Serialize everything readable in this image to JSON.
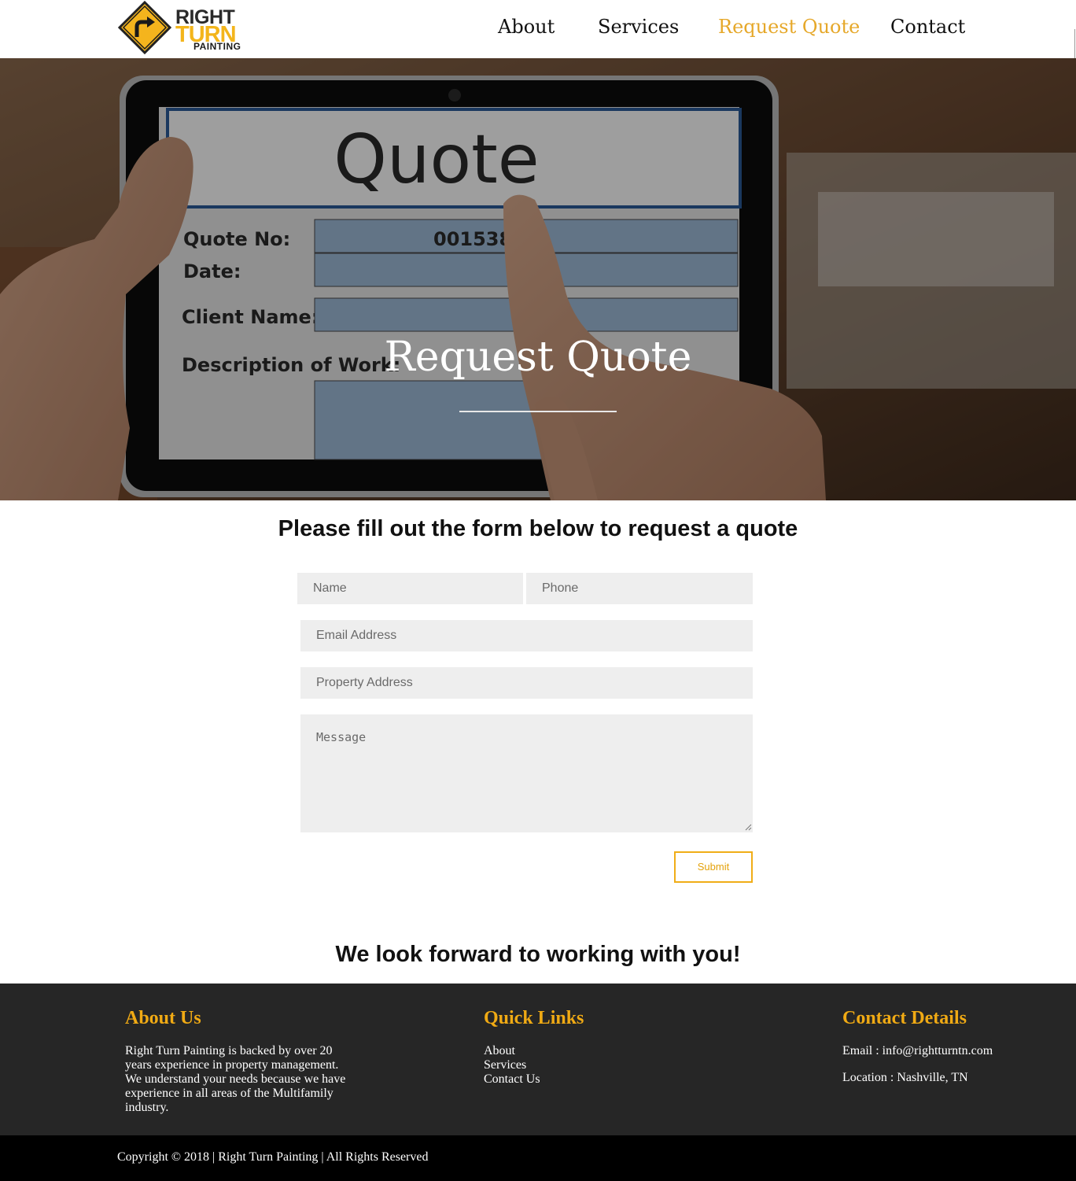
{
  "brand": {
    "logo_line1": "RIGHT",
    "logo_line2": "TURN",
    "logo_line3": "PAINTING",
    "accent_color": "#f0aa14",
    "logo_icon": "right-turn-arrow-sign-icon"
  },
  "nav": {
    "items": [
      "About",
      "Services",
      "Request Quote",
      "Contact"
    ],
    "active": "Request Quote"
  },
  "hero": {
    "title": "Request Quote",
    "image": {
      "heading": "Quote",
      "quote_no_label": "Quote No:",
      "quote_no_value": "001538",
      "date_label": "Date:",
      "client_label": "Client Name:",
      "description_label": "Description of Work:"
    }
  },
  "form": {
    "heading": "Please fill out the form below to request a quote",
    "name_placeholder": "Name",
    "phone_placeholder": "Phone",
    "email_placeholder": "Email Address",
    "property_placeholder": "Property Address",
    "message_placeholder": "Message",
    "submit_label": "Submit"
  },
  "closing": "We look forward to working with you!",
  "footer": {
    "about": {
      "heading": "About Us",
      "text": "Right Turn Painting is backed by over 20 years experience in property management. We understand your needs because we have experience in all areas of the Multifamily industry."
    },
    "quick_links": {
      "heading": "Quick Links",
      "links": [
        "About",
        "Services",
        "Contact Us"
      ]
    },
    "contact": {
      "heading": "Contact Details",
      "email": "Email : info@rightturntn.com",
      "location": "Location : Nashville, TN"
    },
    "copyright": "Copyright © 2018 | Right Turn Painting | All Rights Reserved"
  }
}
